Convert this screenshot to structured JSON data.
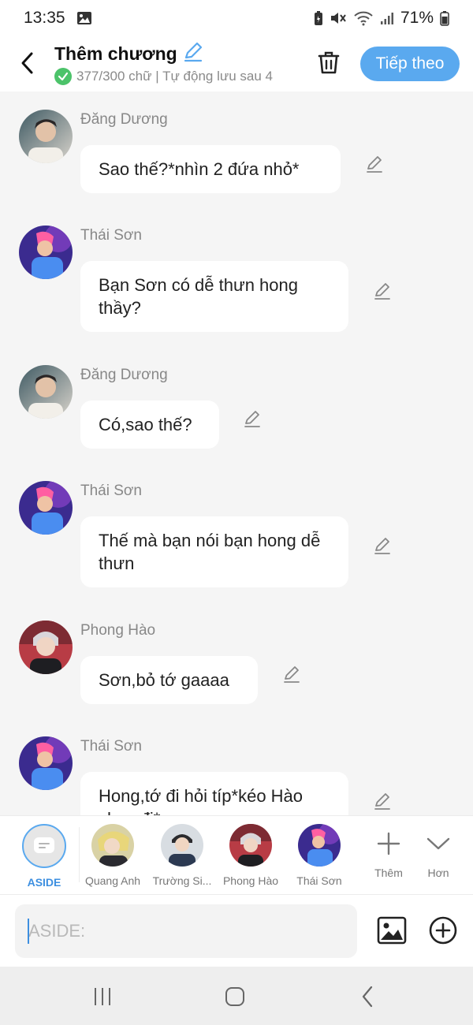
{
  "status_bar": {
    "time": "13:35",
    "battery": "71%"
  },
  "header": {
    "title": "Thêm chương",
    "subtitle": "377/300 chữ | Tự động lưu sau 4",
    "next_label": "Tiếp theo"
  },
  "messages": [
    {
      "sender": "Đăng Dương",
      "text": "Sao thế?*nhìn 2 đứa nhỏ*"
    },
    {
      "sender": "Thái Sơn",
      "text": "Bạn Sơn có dễ thưn hong thầy?"
    },
    {
      "sender": "Đăng Dương",
      "text": "Có,sao thế?"
    },
    {
      "sender": "Thái Sơn",
      "text": "Thế mà bạn nói bạn hong dễ thưn"
    },
    {
      "sender": "Phong Hào",
      "text": "Sơn,bỏ tớ gaaaa"
    },
    {
      "sender": "Thái Sơn",
      "text": "Hong,tớ đi hỏi típ*kéo Hào chạy đi*"
    }
  ],
  "characters": [
    {
      "label": "ASIDE"
    },
    {
      "label": "Quang Anh"
    },
    {
      "label": "Trường Si..."
    },
    {
      "label": "Phong Hào"
    },
    {
      "label": "Thái Sơn"
    }
  ],
  "tools": {
    "add_label": "Thêm",
    "more_label": "Hơn"
  },
  "composer": {
    "placeholder": "ASIDE:"
  },
  "colors": {
    "accent": "#5aa9ef",
    "check": "#4cc36a",
    "aside_label": "#3d8fe0"
  }
}
